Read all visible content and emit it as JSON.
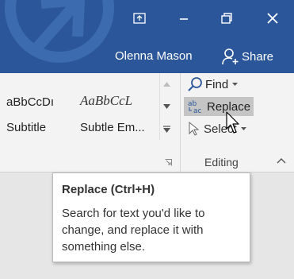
{
  "title_bar": {
    "buttons": [
      {
        "name": "ribbon-display-options-button",
        "icon": "ribbon-display-icon"
      },
      {
        "name": "minimize-button",
        "icon": "minimize-icon"
      },
      {
        "name": "restore-button",
        "icon": "restore-icon"
      },
      {
        "name": "close-button",
        "icon": "close-icon"
      }
    ],
    "user_name": "Olenna Mason",
    "share_label": "Share"
  },
  "styles_gallery": {
    "items": [
      {
        "preview": "aBbCcDı",
        "label": "Subtitle"
      },
      {
        "preview": "AaBbCcL",
        "label": "Subtle Em..."
      }
    ]
  },
  "editing_group": {
    "find_label": "Find",
    "replace_label": "Replace",
    "select_label": "Select",
    "group_label": "Editing"
  },
  "tooltip": {
    "title": "Replace (Ctrl+H)",
    "body": "Search for text you'd like to change, and replace it with something else."
  },
  "colors": {
    "title_bar": "#2b579a",
    "ribbon": "#f3f3f3",
    "hover": "#c5c5c5",
    "document_bg": "#e6e6e6",
    "find_icon": "#2b579a"
  }
}
